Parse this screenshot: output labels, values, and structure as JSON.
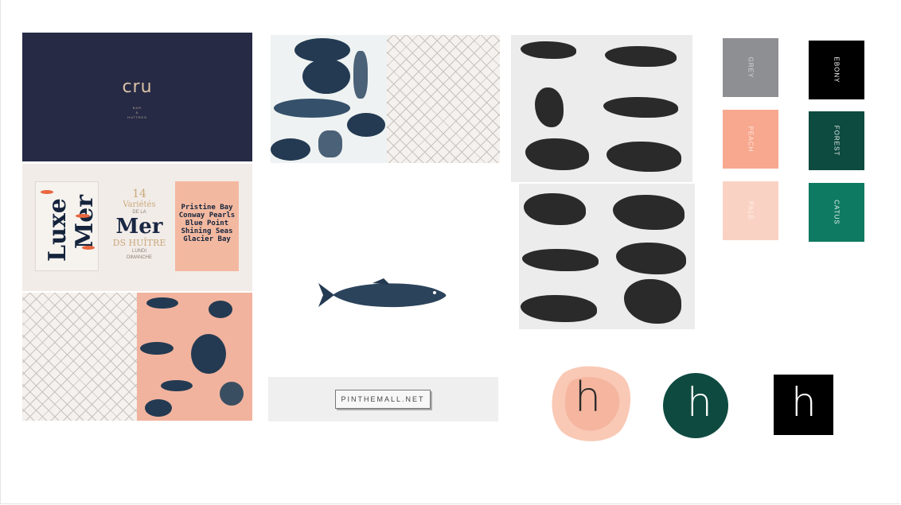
{
  "cru": {
    "logo": "cru",
    "sub_lines": [
      "BAR",
      "À",
      "HUÎTRES"
    ]
  },
  "poster_left": {
    "word1": "Luxe",
    "word2": "Mer"
  },
  "poster_middle": {
    "number": "14",
    "varietes": "Variétés",
    "de_la": "DE LA",
    "mer": "Mer",
    "huitre": "DS HUÎTRE",
    "days": [
      "LUNDI",
      "DIMANCHE"
    ]
  },
  "poster_right": {
    "lines": [
      "Pristine Bay",
      "Conway Pearls",
      "Blue Point",
      "Shining Seas",
      "Glacier Bay"
    ]
  },
  "pin_watermark": "PINTHEMALL.NET",
  "swatches": [
    {
      "label": "GREY",
      "color": "#8e8f93",
      "text_color": "#d8d8d8"
    },
    {
      "label": "EBONY",
      "color": "#000000",
      "text_color": "#ffffff"
    },
    {
      "label": "PEACH",
      "color": "#f7a88e",
      "text_color": "#fde9e1"
    },
    {
      "label": "FOREST",
      "color": "#0d4a3f",
      "text_color": "#e6efec"
    },
    {
      "label": "PALE",
      "color": "#fad2c3",
      "text_color": "#fff1eb"
    },
    {
      "label": "CATUS",
      "color": "#0f7a62",
      "text_color": "#e8f4f0"
    }
  ],
  "logos": {
    "mark": "h"
  },
  "colors": {
    "navy": "#262a45",
    "peach": "#f1b39e",
    "ink": "#233a52",
    "forest": "#0e4a40"
  }
}
